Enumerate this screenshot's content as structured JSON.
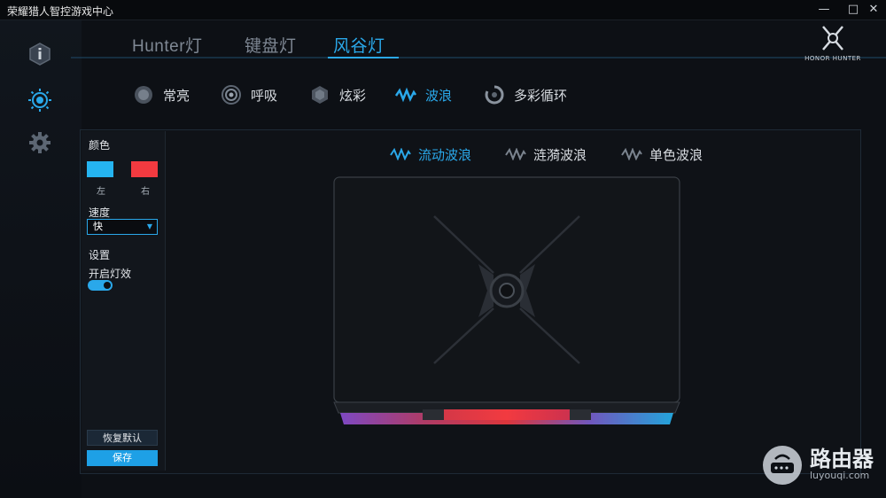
{
  "window": {
    "title": "荣耀猎人智控游戏中心",
    "minimize": "—",
    "maximize": "□",
    "close": "✕"
  },
  "main_tabs": [
    {
      "label": "Hunter灯",
      "active": false
    },
    {
      "label": "键盘灯",
      "active": false
    },
    {
      "label": "风谷灯",
      "active": true
    }
  ],
  "logo": {
    "text": "HONOR HUNTER"
  },
  "modes": [
    {
      "label": "常亮",
      "icon": "steady-light-icon",
      "active": false
    },
    {
      "label": "呼吸",
      "icon": "breathing-icon",
      "active": false
    },
    {
      "label": "炫彩",
      "icon": "colorful-icon",
      "active": false
    },
    {
      "label": "波浪",
      "icon": "wave-icon",
      "active": true
    },
    {
      "label": "多彩循环",
      "icon": "color-cycle-icon",
      "active": false
    }
  ],
  "sidebar": {
    "color_label": "颜色",
    "left_label": "左",
    "right_label": "右",
    "left_color": "#25b4f0",
    "right_color": "#f23a40",
    "speed_label": "速度",
    "speed_value": "快",
    "settings_label": "设置",
    "light_toggle_label": "开启灯效",
    "light_toggle_on": true,
    "reset_label": "恢复默认",
    "save_label": "保存"
  },
  "submodes": [
    {
      "label": "流动波浪",
      "active": true
    },
    {
      "label": "涟漪波浪",
      "active": false
    },
    {
      "label": "单色波浪",
      "active": false
    }
  ],
  "watermark": {
    "brand": "路由器",
    "site": "luyouqi.com"
  },
  "colors": {
    "accent": "#2aa8ea",
    "bg": "#0d1015"
  }
}
